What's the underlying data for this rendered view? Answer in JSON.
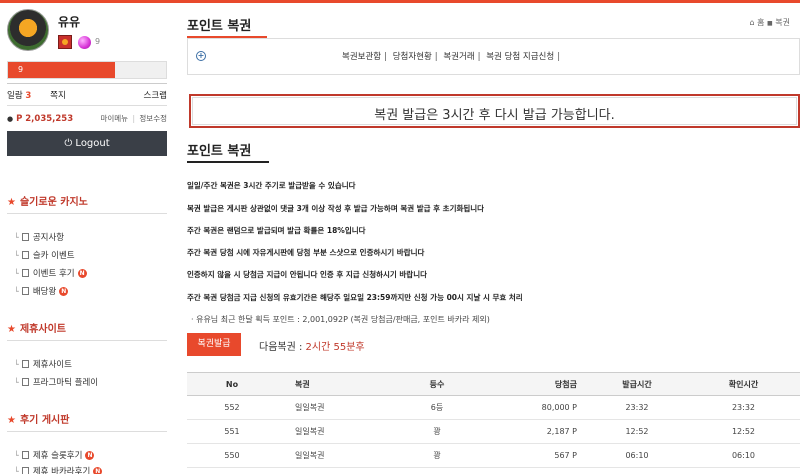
{
  "profile": {
    "username": "유유",
    "level": "9",
    "xp_bar_level": "9",
    "xp_fill_fraction": 0.68,
    "attendance_label": "일람",
    "attendance_count": "3",
    "note_label": "쪽지",
    "scrap_label": "스크랩",
    "points": "P 2,035,253",
    "mymenu_label": "마이메뉴",
    "info_edit_label": "정보수정",
    "logout_label": "Logout"
  },
  "sidebar": {
    "section1": {
      "title": "슬기로운 카지노",
      "items": [
        {
          "label": "공지사항",
          "new": false
        },
        {
          "label": "슬카 이벤트",
          "new": false
        },
        {
          "label": "이벤트 후기",
          "new": true
        },
        {
          "label": "배당왕",
          "new": true
        }
      ]
    },
    "section2": {
      "title": "제휴사이트",
      "items": [
        {
          "label": "제휴사이트",
          "new": false
        },
        {
          "label": "프라그마틱 플레이",
          "new": false
        }
      ]
    },
    "section3": {
      "title": "후기 게시판",
      "items": [
        {
          "label": "제휴 슬롯후기",
          "new": true
        },
        {
          "label": "제휴 바카라후기",
          "new": true
        }
      ]
    },
    "new_badge_text": "N"
  },
  "header": {
    "title": "포인트 복권",
    "breadcrumb_home": "홈",
    "breadcrumb_current": "복권"
  },
  "subnav": {
    "items": [
      "복권보관함",
      "당첨자현황",
      "복권거래",
      "복권 당첨 지급신청"
    ],
    "separator": "|"
  },
  "alert": {
    "text": "복권 발급은 3시간 후 다시 발급 가능합니다."
  },
  "section": {
    "title": "포인트 복권"
  },
  "info_lines": [
    "일일/주간 복권은 3시간 주기로 발급받을 수 있습니다",
    "복권 발급은 게시판 상관없이 댓글 3개 이상 작성 후 발급 가능하며 복권 발급 후 초기화됩니다",
    "주간 복권은 랜덤으로 발급되며 발급 확률은 18%입니다",
    "주간 복권 당첨 시에 자유게시판에 당첨 부분 스샷으로 인증하시기 바랍니다",
    "인증하지 않을 시 당첨금 지급이 안됩니다 인증 후 지급 신청하시기 바랍니다",
    "주간 복권 당첨금 지급 신청의 유효기간은 해당주 일요일 23:59까지만 신청 가능 00시 지날 시 무효 처리"
  ],
  "notice": "· 유유님 최근 한달 획득 포인트 : 2,001,092P (복권 당첨금/판매금, 포인트 바카라 제외)",
  "apply_button": "복권발급",
  "next_lottery": {
    "label": "다음복권 : ",
    "value": "2시간 55분후"
  },
  "table": {
    "headers": [
      "No",
      "복권",
      "등수",
      "당첨금",
      "발급시간",
      "확인시간"
    ],
    "rows": [
      [
        "552",
        "일일복권",
        "6등",
        "80,000 P",
        "23:32",
        "23:32"
      ],
      [
        "551",
        "일일복권",
        "꽝",
        "2,187 P",
        "12:52",
        "12:52"
      ],
      [
        "550",
        "일일복권",
        "꽝",
        "567 P",
        "06:10",
        "06:10"
      ]
    ]
  }
}
